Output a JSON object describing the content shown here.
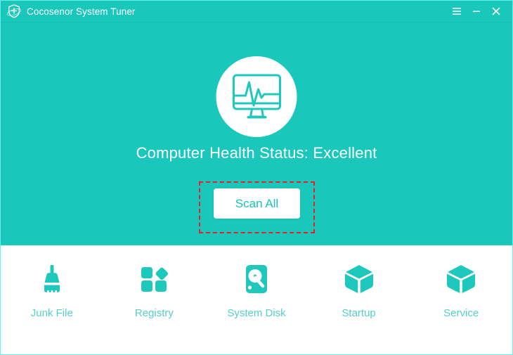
{
  "window": {
    "title": "Cocosenor System Tuner",
    "logo_icon": "shield-plus-icon",
    "border_color": "#66f0f0"
  },
  "titlebar": {
    "menu_icon": "hamburger-menu-icon",
    "minimize_icon": "minimize-icon",
    "close_icon": "close-icon",
    "background_color": "#1ac7bb"
  },
  "hero": {
    "background_color": "#1ac7bb",
    "health_icon": "monitor-heartbeat-icon",
    "status_text": "Computer Health Status: Excellent",
    "status_color": "#ffffff",
    "scan_button_label": "Scan All",
    "scan_button_text_color": "#18c3b8",
    "annotation_color": "#ee1c25"
  },
  "tools": {
    "label_color": "#56cfc8",
    "icon_color": "#1ec8bd",
    "items": [
      {
        "label": "Junk File",
        "icon": "broom-icon"
      },
      {
        "label": "Registry",
        "icon": "registry-blocks-icon"
      },
      {
        "label": "System Disk",
        "icon": "hard-disk-icon"
      },
      {
        "label": "Startup",
        "icon": "cube-icon"
      },
      {
        "label": "Service",
        "icon": "cube-icon"
      }
    ]
  }
}
